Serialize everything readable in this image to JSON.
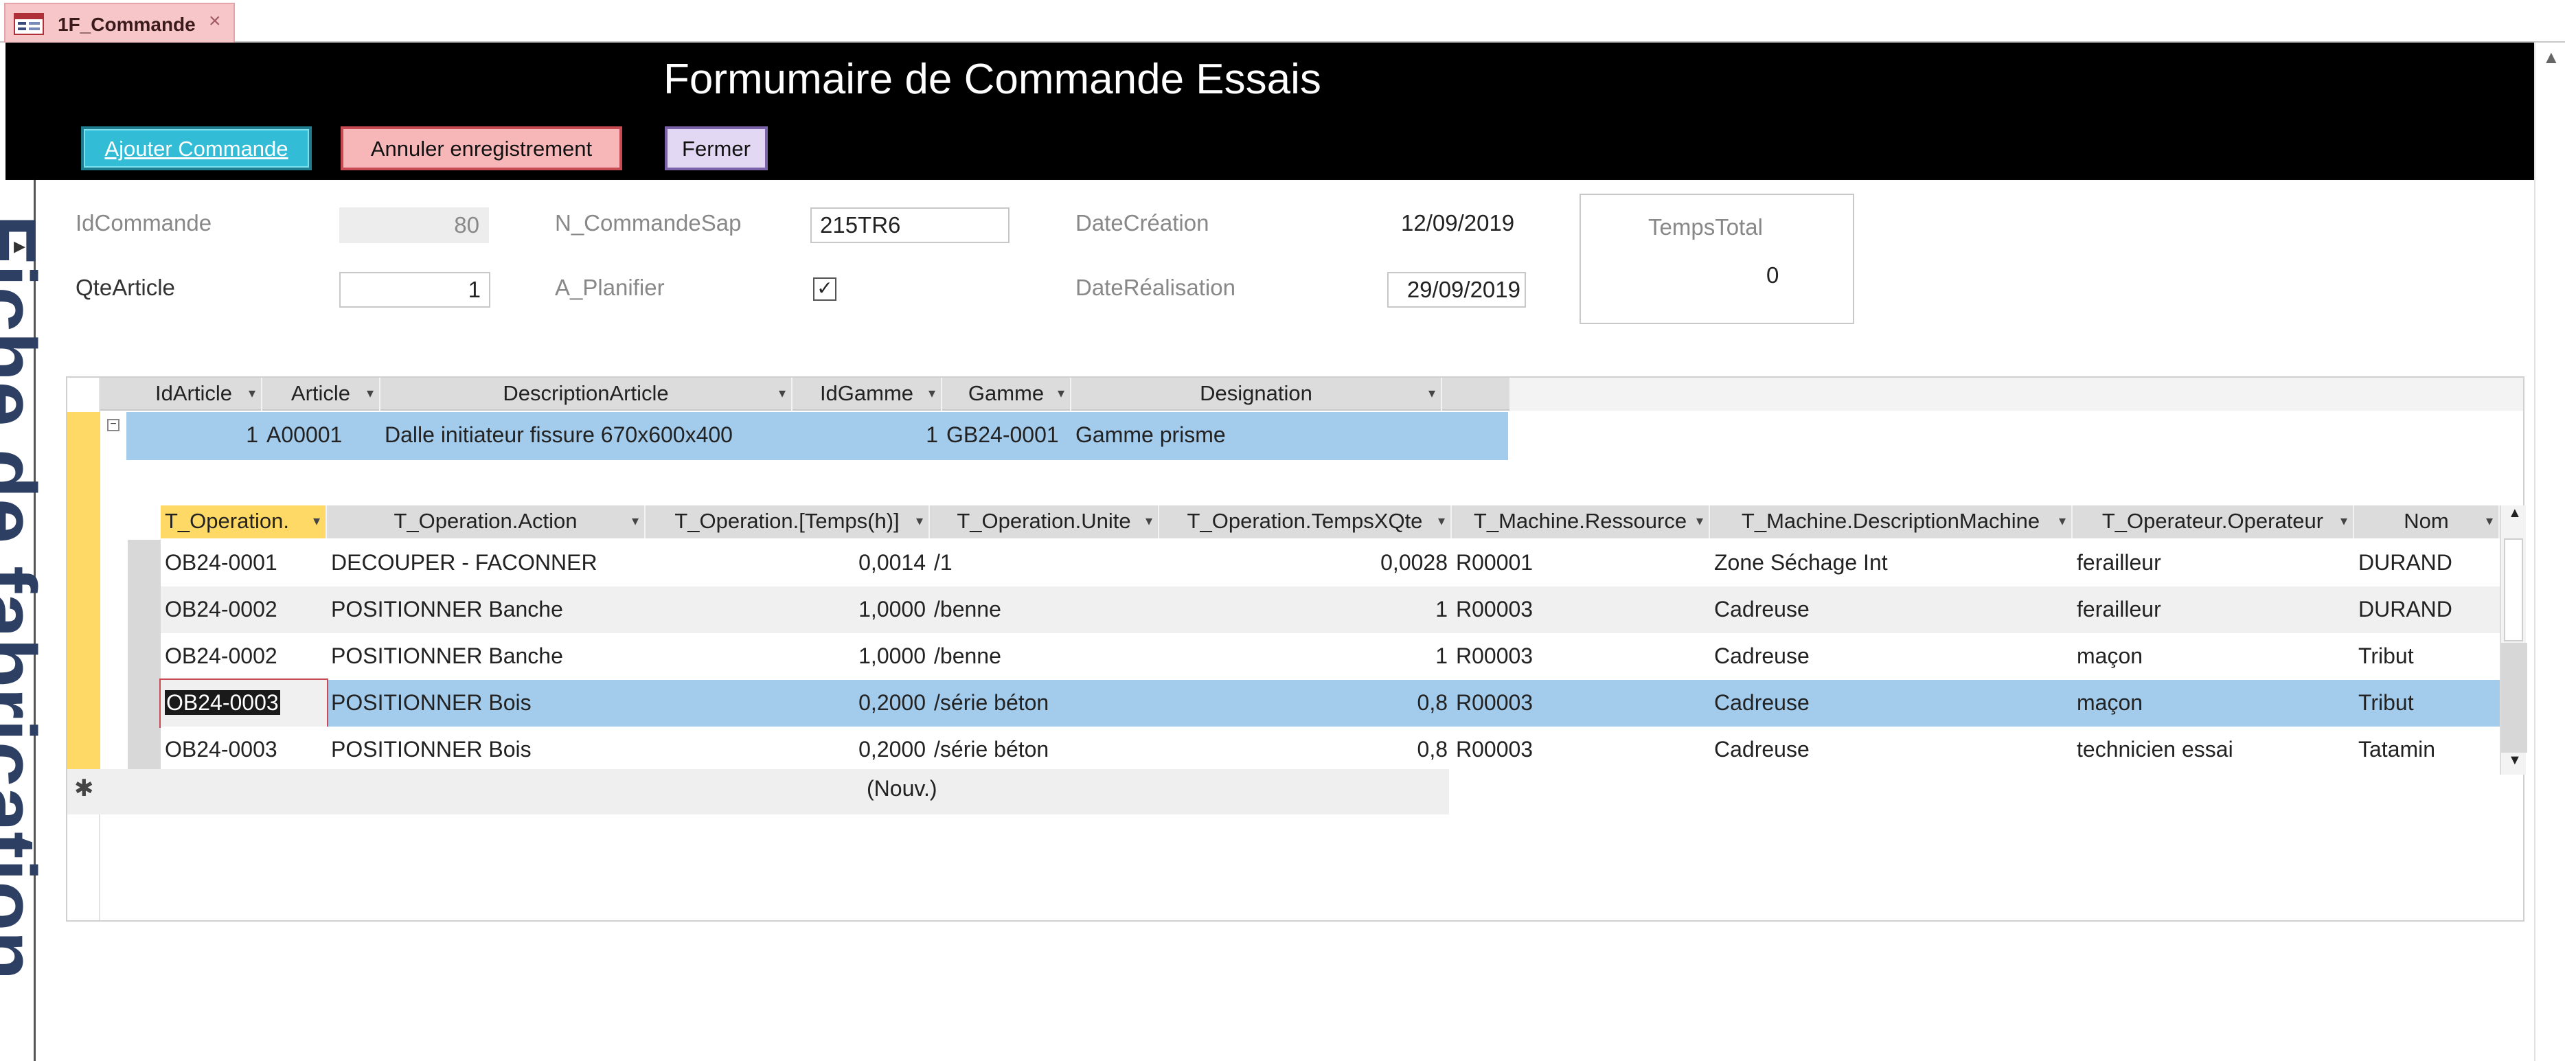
{
  "tab": {
    "title": "1F_Commande",
    "close": "×"
  },
  "form": {
    "title": "Formumaire de Commande Essais",
    "side_title": "Fiche de fabrication",
    "buttons": {
      "add": "Ajouter Commande",
      "cancel": "Annuler enregistrement",
      "close": "Fermer"
    },
    "fields": {
      "id_label": "IdCommande",
      "id_value": "80",
      "sap_label": "N_CommandeSap",
      "sap_value": "215TR6",
      "creation_label": "DateCréation",
      "creation_value": "12/09/2019",
      "qte_label": "QteArticle",
      "qte_value": "1",
      "plan_label": "A_Planifier",
      "plan_checked": "☑",
      "real_label": "DateRéalisation",
      "real_value": "29/09/2019",
      "temps_label": "TempsTotal",
      "temps_value": "0"
    }
  },
  "subform": {
    "columns": [
      "IdArticle",
      "Article",
      "DescriptionArticle",
      "IdGamme",
      "Gamme",
      "Designation"
    ],
    "row": {
      "id_article": "1",
      "article": "A00001",
      "description": "Dalle initiateur fissure 670x600x400",
      "id_gamme": "1",
      "gamme": "GB24-0001",
      "designation": "Gamme prisme"
    },
    "new_row_label": "(Nouv.)",
    "child_columns": [
      "T_Operation.",
      "T_Operation.Action",
      "T_Operation.[Temps(h)]",
      "T_Operation.Unite",
      "T_Operation.TempsXQte",
      "T_Machine.Ressource",
      "T_Machine.DescriptionMachine",
      "T_Operateur.Operateur",
      "Nom"
    ],
    "child_rows": [
      {
        "op": "OB24-0001",
        "action": "DECOUPER - FACONNER",
        "temps": "0,0014",
        "unite": "/1",
        "tempsx": "0,0028",
        "ress": "R00001",
        "desc": "Zone Séchage Int",
        "operateur": "ferailleur",
        "nom": "DURAND"
      },
      {
        "op": "OB24-0002",
        "action": "POSITIONNER Banche",
        "temps": "1,0000",
        "unite": "/benne",
        "tempsx": "1",
        "ress": "R00003",
        "desc": "Cadreuse",
        "operateur": "ferailleur",
        "nom": "DURAND"
      },
      {
        "op": "OB24-0002",
        "action": "POSITIONNER Banche",
        "temps": "1,0000",
        "unite": "/benne",
        "tempsx": "1",
        "ress": "R00003",
        "desc": "Cadreuse",
        "operateur": "maçon",
        "nom": "Tribut"
      },
      {
        "op": "OB24-0003",
        "action": "POSITIONNER Bois",
        "temps": "0,2000",
        "unite": "/série béton",
        "tempsx": "0,8",
        "ress": "R00003",
        "desc": "Cadreuse",
        "operateur": "maçon",
        "nom": "Tribut"
      },
      {
        "op": "OB24-0003",
        "action": "POSITIONNER Bois",
        "temps": "0,2000",
        "unite": "/série béton",
        "tempsx": "0,8",
        "ress": "R00003",
        "desc": "Cadreuse",
        "operateur": "technicien essai",
        "nom": "Tatamin"
      }
    ]
  },
  "colors": {
    "header_bg": "#000000",
    "selection": "#a3cbec",
    "add_btn": "#33bcd6",
    "cancel_btn": "#f7b7b9",
    "close_btn": "#e2d8f3",
    "record_selector": "#ffd966"
  }
}
